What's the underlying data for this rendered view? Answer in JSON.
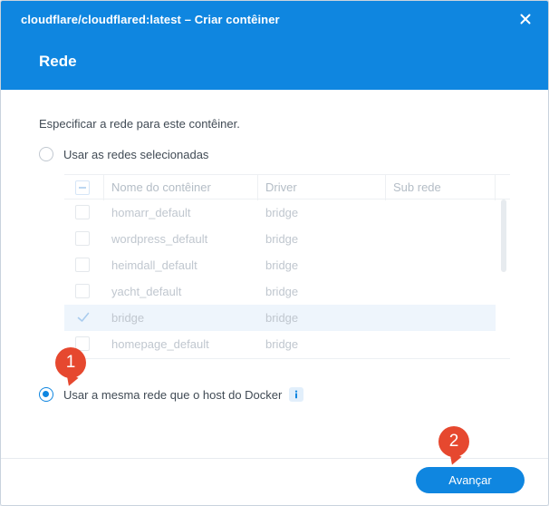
{
  "window": {
    "title": "cloudflare/cloudflared:latest – Criar contêiner",
    "close_icon": "close-icon"
  },
  "section": {
    "title": "Rede"
  },
  "instruction": "Especificar a rede para este contêiner.",
  "options": {
    "selected_networks": {
      "label": "Usar as redes selecionadas",
      "checked": false
    },
    "host_network": {
      "label": "Usar a mesma rede que o host do Docker",
      "checked": true,
      "info_icon": "info-icon"
    }
  },
  "network_table": {
    "columns": [
      "Nome do contêiner",
      "Driver",
      "Sub rede"
    ],
    "rows": [
      {
        "name": "homarr_default",
        "driver": "bridge",
        "checked": false
      },
      {
        "name": "wordpress_default",
        "driver": "bridge",
        "checked": false
      },
      {
        "name": "heimdall_default",
        "driver": "bridge",
        "checked": false
      },
      {
        "name": "yacht_default",
        "driver": "bridge",
        "checked": false
      },
      {
        "name": "bridge",
        "driver": "bridge",
        "checked": true
      },
      {
        "name": "homepage_default",
        "driver": "bridge",
        "checked": false
      }
    ]
  },
  "annotations": {
    "badge_1": "1",
    "badge_2": "2"
  },
  "footer": {
    "next_label": "Avançar"
  },
  "colors": {
    "accent": "#0f86e0",
    "badge": "#e6482f"
  }
}
